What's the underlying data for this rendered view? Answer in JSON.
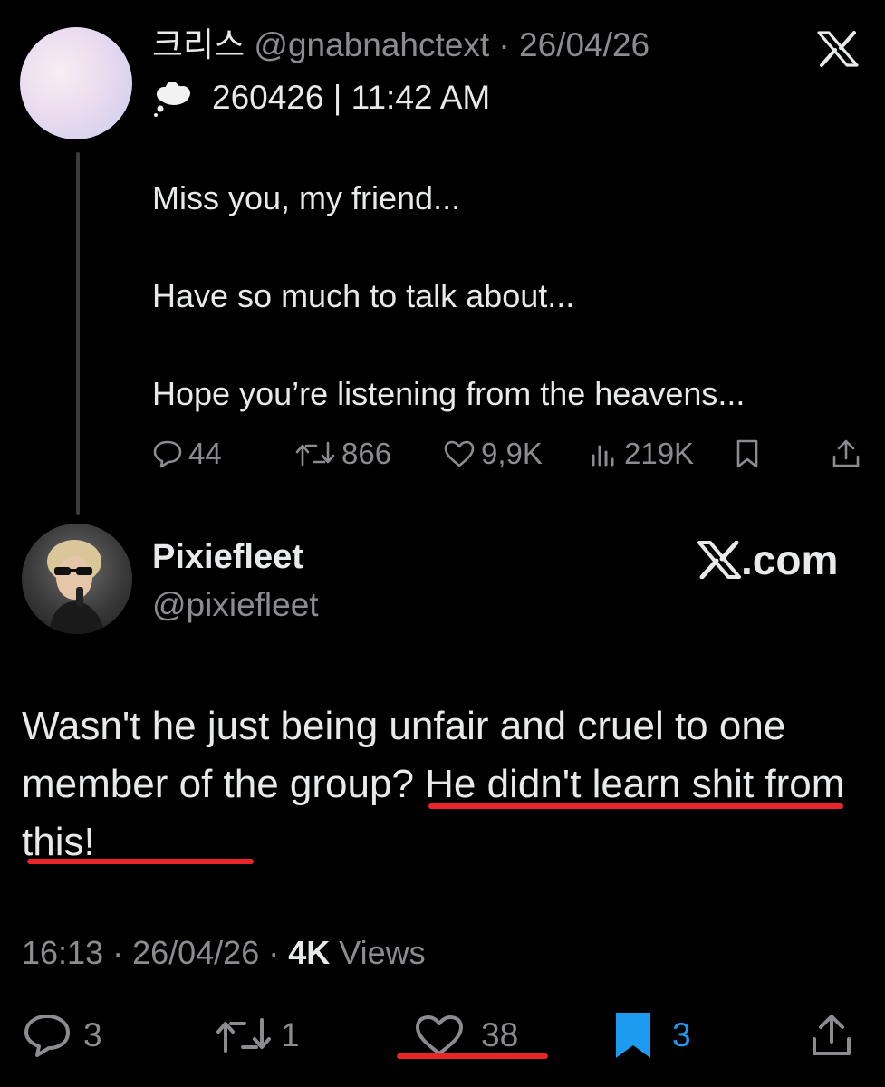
{
  "quoted_tweet": {
    "display_name": "크리스",
    "handle": "@gnabnahctext",
    "separator": " · ",
    "date": "26/04/26",
    "subtitle": "260426 | 11:42 AM",
    "lines": [
      "Miss you, my friend...",
      "Have so much to talk about...",
      "Hope you’re listening from the heavens..."
    ],
    "stats": {
      "replies": "44",
      "reposts": "866",
      "likes": "9,9K",
      "views": "219K"
    }
  },
  "reply_tweet": {
    "display_name": "Pixiefleet",
    "handle": "@pixiefleet",
    "brand": ".com",
    "text_part1": "Wasn't he just being unfair and cruel to one member of the group? ",
    "text_part2": "He didn't learn shit from this!",
    "time": "16:13",
    "separator": " · ",
    "date": "26/04/26",
    "views_count": "4K",
    "views_label": " Views",
    "stats": {
      "replies": "3",
      "reposts": "1",
      "likes": "38",
      "bookmarks": "3"
    }
  },
  "colors": {
    "background": "#000000",
    "text": "#e7e9ea",
    "secondary": "#8b8b90",
    "accent_blue": "#1d9bf0",
    "annotation_red": "#e8262a"
  },
  "icons": [
    "cloud-icon",
    "x-logo-icon",
    "reply-icon",
    "repost-icon",
    "like-icon",
    "views-icon",
    "bookmark-icon",
    "share-icon"
  ]
}
